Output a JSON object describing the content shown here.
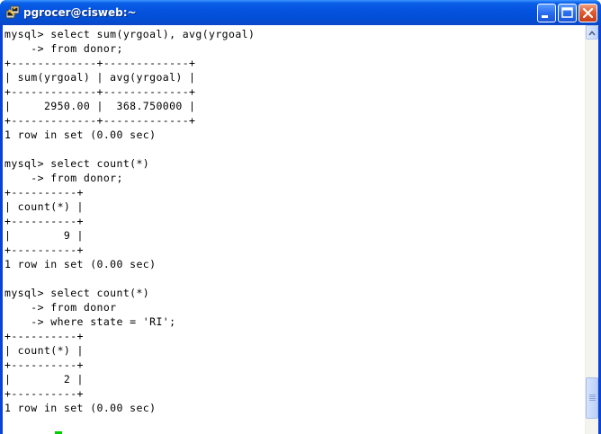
{
  "window": {
    "title": "pgrocer@cisweb:~",
    "icon": "putty-terminal-icon"
  },
  "terminal": {
    "lines": [
      "mysql> select sum(yrgoal), avg(yrgoal)",
      "    -> from donor;",
      "+-------------+-------------+",
      "| sum(yrgoal) | avg(yrgoal) |",
      "+-------------+-------------+",
      "|     2950.00 |  368.750000 |",
      "+-------------+-------------+",
      "1 row in set (0.00 sec)",
      "",
      "mysql> select count(*)",
      "    -> from donor;",
      "+----------+",
      "| count(*) |",
      "+----------+",
      "|        9 |",
      "+----------+",
      "1 row in set (0.00 sec)",
      "",
      "mysql> select count(*)",
      "    -> from donor",
      "    -> where state = 'RI';",
      "+----------+",
      "| count(*) |",
      "+----------+",
      "|        2 |",
      "+----------+",
      "1 row in set (0.00 sec)"
    ]
  },
  "colors": {
    "titlebar": "#0553df",
    "close_button": "#e05a30",
    "cursor": "#00d000",
    "terminal_bg": "#ffffff",
    "terminal_fg": "#000000"
  }
}
